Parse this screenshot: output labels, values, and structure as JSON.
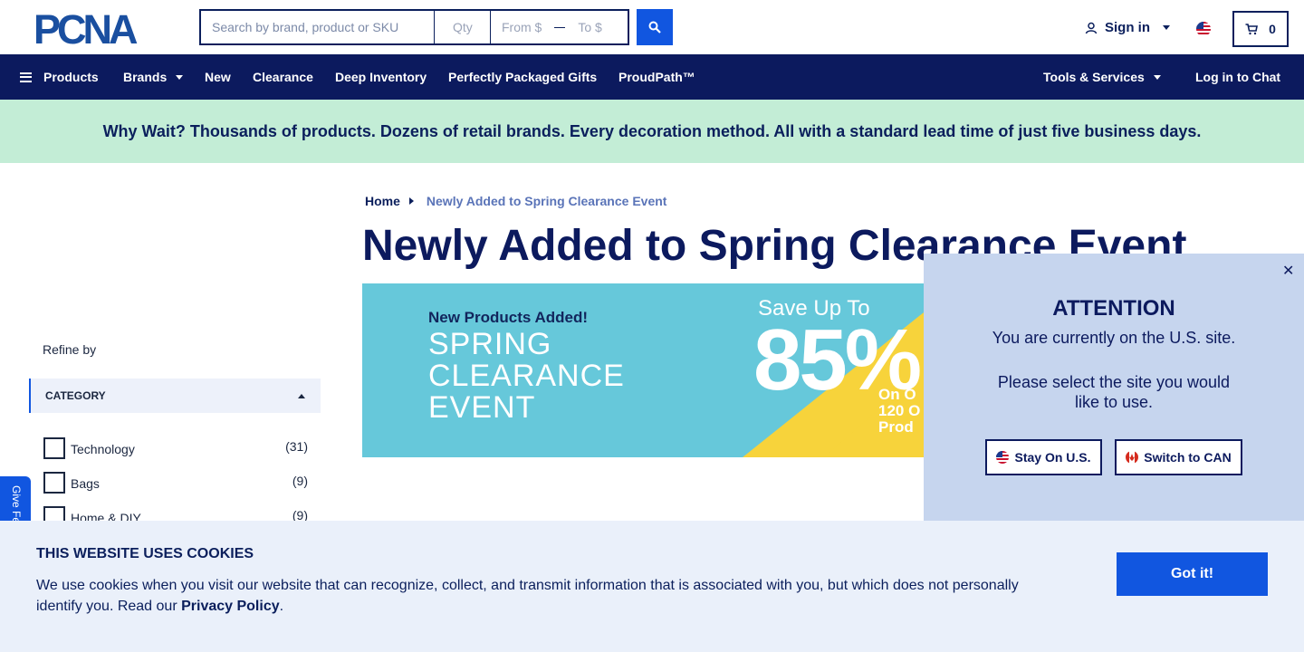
{
  "header": {
    "logo_text": "PCNA",
    "search_placeholder": "Search by brand, product or SKU",
    "qty_placeholder": "Qty",
    "from_placeholder": "From $",
    "to_placeholder": "To $",
    "signin_label": "Sign in",
    "cart_count": "0"
  },
  "nav": {
    "items": [
      {
        "label": "Products"
      },
      {
        "label": "Brands"
      },
      {
        "label": "New"
      },
      {
        "label": "Clearance"
      },
      {
        "label": "Deep Inventory"
      },
      {
        "label": "Perfectly Packaged Gifts"
      },
      {
        "label": "ProudPath™"
      }
    ],
    "right": [
      {
        "label": "Tools & Services"
      },
      {
        "label": "Log in to Chat"
      }
    ]
  },
  "promo": {
    "text": "Why Wait? Thousands of products. Dozens of retail brands. Every decoration method. All with a standard lead time of just five business days."
  },
  "breadcrumb": {
    "home": "Home",
    "current": "Newly Added to Spring Clearance Event"
  },
  "page": {
    "title": "Newly Added to Spring Clearance Event"
  },
  "hero": {
    "small": "New Products Added!",
    "line1": "SPRING",
    "line2": "CLEARANCE",
    "line3": "EVENT",
    "save": "Save Up To",
    "percent": "85%",
    "on1": "On O",
    "on2": "120 O",
    "on3": "Prod"
  },
  "sidebar": {
    "refine_label": "Refine by",
    "category_heading": "CATEGORY",
    "categories": [
      {
        "label": "Technology",
        "count": "(31)"
      },
      {
        "label": "Bags",
        "count": "(9)"
      },
      {
        "label": "Home & DIY",
        "count": "(9)"
      }
    ],
    "feedback_label": "Give Fe"
  },
  "modal": {
    "title": "ATTENTION",
    "line1": "You are currently on the U.S. site.",
    "line2": "Please select the site you would",
    "line3": "like to use.",
    "stay_label": "Stay On U.S.",
    "switch_label": "Switch to CAN"
  },
  "cookies": {
    "title": "THIS WEBSITE USES COOKIES",
    "text": "We use cookies when you visit our website that can recognize, collect, and transmit information that is associated with you, but which does not personally identify you. Read our ",
    "link": "Privacy Policy",
    "suffix": ".",
    "button": "Got it!"
  },
  "colors": {
    "navy": "#0c1a5e",
    "accent_blue": "#1156e0",
    "promo_green": "#c3edd6",
    "modal_bg": "#c6d5ee",
    "cookie_bg": "#eaf0fa",
    "hero_teal": "#66c8da",
    "hero_yellow": "#f7d33b"
  }
}
